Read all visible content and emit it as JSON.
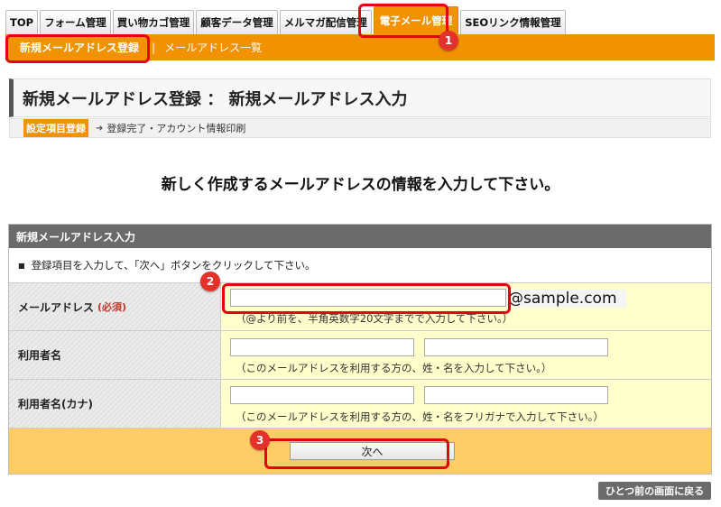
{
  "tabs": [
    "TOP",
    "フォーム管理",
    "買い物カゴ管理",
    "顧客データ管理",
    "メルマガ配信管理",
    "電子メール管理",
    "SEOリンク情報管理"
  ],
  "active_tab_index": 5,
  "subnav": {
    "current": "新規メールアドレス登録",
    "separator": "|",
    "link": "メールアドレス一覧"
  },
  "page_title": "新規メールアドレス登録 ： 新規メールアドレス入力",
  "steps": {
    "current": "設定項目登録",
    "next": "登録完了・アカウント情報印刷"
  },
  "heading": "新しく作成するメールアドレスの情報を入力して下さい。",
  "form": {
    "header": "新規メールアドレス入力",
    "note": "登録項目を入力して、「次へ」ボタンをクリックして下さい。",
    "rows": [
      {
        "label": "メールアドレス",
        "required": "(必須)",
        "value": "",
        "domain": "@sample.com",
        "hint": "（@より前を、半角英数字20文字までで入力して下さい。）"
      },
      {
        "label": "利用者名",
        "last": "",
        "first": "",
        "hint": "（このメールアドレスを利用する方の、姓・名を入力して下さい。）"
      },
      {
        "label": "利用者名(カナ)",
        "last": "",
        "first": "",
        "hint": "（このメールアドレスを利用する方の、姓・名をフリガナで入力して下さい。）"
      }
    ],
    "next_button": "次へ"
  },
  "back_button": "ひとつ前の画面に戻る",
  "callouts": [
    "1",
    "2",
    "3"
  ],
  "colors": {
    "accent": "#f39200",
    "callout": "#e50012",
    "input_bg": "#ffffcc",
    "button_row_bg": "#ffcc66",
    "header_bg": "#6b6b6b"
  }
}
